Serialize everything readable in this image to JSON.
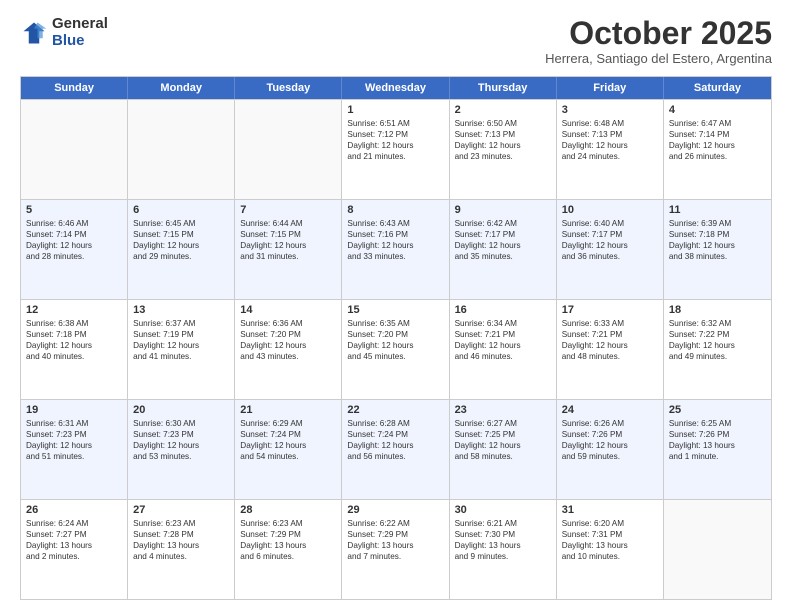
{
  "header": {
    "logo_general": "General",
    "logo_blue": "Blue",
    "month_title": "October 2025",
    "subtitle": "Herrera, Santiago del Estero, Argentina"
  },
  "days": [
    "Sunday",
    "Monday",
    "Tuesday",
    "Wednesday",
    "Thursday",
    "Friday",
    "Saturday"
  ],
  "rows": [
    [
      {
        "date": "",
        "info": ""
      },
      {
        "date": "",
        "info": ""
      },
      {
        "date": "",
        "info": ""
      },
      {
        "date": "1",
        "info": "Sunrise: 6:51 AM\nSunset: 7:12 PM\nDaylight: 12 hours\nand 21 minutes."
      },
      {
        "date": "2",
        "info": "Sunrise: 6:50 AM\nSunset: 7:13 PM\nDaylight: 12 hours\nand 23 minutes."
      },
      {
        "date": "3",
        "info": "Sunrise: 6:48 AM\nSunset: 7:13 PM\nDaylight: 12 hours\nand 24 minutes."
      },
      {
        "date": "4",
        "info": "Sunrise: 6:47 AM\nSunset: 7:14 PM\nDaylight: 12 hours\nand 26 minutes."
      }
    ],
    [
      {
        "date": "5",
        "info": "Sunrise: 6:46 AM\nSunset: 7:14 PM\nDaylight: 12 hours\nand 28 minutes."
      },
      {
        "date": "6",
        "info": "Sunrise: 6:45 AM\nSunset: 7:15 PM\nDaylight: 12 hours\nand 29 minutes."
      },
      {
        "date": "7",
        "info": "Sunrise: 6:44 AM\nSunset: 7:15 PM\nDaylight: 12 hours\nand 31 minutes."
      },
      {
        "date": "8",
        "info": "Sunrise: 6:43 AM\nSunset: 7:16 PM\nDaylight: 12 hours\nand 33 minutes."
      },
      {
        "date": "9",
        "info": "Sunrise: 6:42 AM\nSunset: 7:17 PM\nDaylight: 12 hours\nand 35 minutes."
      },
      {
        "date": "10",
        "info": "Sunrise: 6:40 AM\nSunset: 7:17 PM\nDaylight: 12 hours\nand 36 minutes."
      },
      {
        "date": "11",
        "info": "Sunrise: 6:39 AM\nSunset: 7:18 PM\nDaylight: 12 hours\nand 38 minutes."
      }
    ],
    [
      {
        "date": "12",
        "info": "Sunrise: 6:38 AM\nSunset: 7:18 PM\nDaylight: 12 hours\nand 40 minutes."
      },
      {
        "date": "13",
        "info": "Sunrise: 6:37 AM\nSunset: 7:19 PM\nDaylight: 12 hours\nand 41 minutes."
      },
      {
        "date": "14",
        "info": "Sunrise: 6:36 AM\nSunset: 7:20 PM\nDaylight: 12 hours\nand 43 minutes."
      },
      {
        "date": "15",
        "info": "Sunrise: 6:35 AM\nSunset: 7:20 PM\nDaylight: 12 hours\nand 45 minutes."
      },
      {
        "date": "16",
        "info": "Sunrise: 6:34 AM\nSunset: 7:21 PM\nDaylight: 12 hours\nand 46 minutes."
      },
      {
        "date": "17",
        "info": "Sunrise: 6:33 AM\nSunset: 7:21 PM\nDaylight: 12 hours\nand 48 minutes."
      },
      {
        "date": "18",
        "info": "Sunrise: 6:32 AM\nSunset: 7:22 PM\nDaylight: 12 hours\nand 49 minutes."
      }
    ],
    [
      {
        "date": "19",
        "info": "Sunrise: 6:31 AM\nSunset: 7:23 PM\nDaylight: 12 hours\nand 51 minutes."
      },
      {
        "date": "20",
        "info": "Sunrise: 6:30 AM\nSunset: 7:23 PM\nDaylight: 12 hours\nand 53 minutes."
      },
      {
        "date": "21",
        "info": "Sunrise: 6:29 AM\nSunset: 7:24 PM\nDaylight: 12 hours\nand 54 minutes."
      },
      {
        "date": "22",
        "info": "Sunrise: 6:28 AM\nSunset: 7:24 PM\nDaylight: 12 hours\nand 56 minutes."
      },
      {
        "date": "23",
        "info": "Sunrise: 6:27 AM\nSunset: 7:25 PM\nDaylight: 12 hours\nand 58 minutes."
      },
      {
        "date": "24",
        "info": "Sunrise: 6:26 AM\nSunset: 7:26 PM\nDaylight: 12 hours\nand 59 minutes."
      },
      {
        "date": "25",
        "info": "Sunrise: 6:25 AM\nSunset: 7:26 PM\nDaylight: 13 hours\nand 1 minute."
      }
    ],
    [
      {
        "date": "26",
        "info": "Sunrise: 6:24 AM\nSunset: 7:27 PM\nDaylight: 13 hours\nand 2 minutes."
      },
      {
        "date": "27",
        "info": "Sunrise: 6:23 AM\nSunset: 7:28 PM\nDaylight: 13 hours\nand 4 minutes."
      },
      {
        "date": "28",
        "info": "Sunrise: 6:23 AM\nSunset: 7:29 PM\nDaylight: 13 hours\nand 6 minutes."
      },
      {
        "date": "29",
        "info": "Sunrise: 6:22 AM\nSunset: 7:29 PM\nDaylight: 13 hours\nand 7 minutes."
      },
      {
        "date": "30",
        "info": "Sunrise: 6:21 AM\nSunset: 7:30 PM\nDaylight: 13 hours\nand 9 minutes."
      },
      {
        "date": "31",
        "info": "Sunrise: 6:20 AM\nSunset: 7:31 PM\nDaylight: 13 hours\nand 10 minutes."
      },
      {
        "date": "",
        "info": ""
      }
    ]
  ]
}
